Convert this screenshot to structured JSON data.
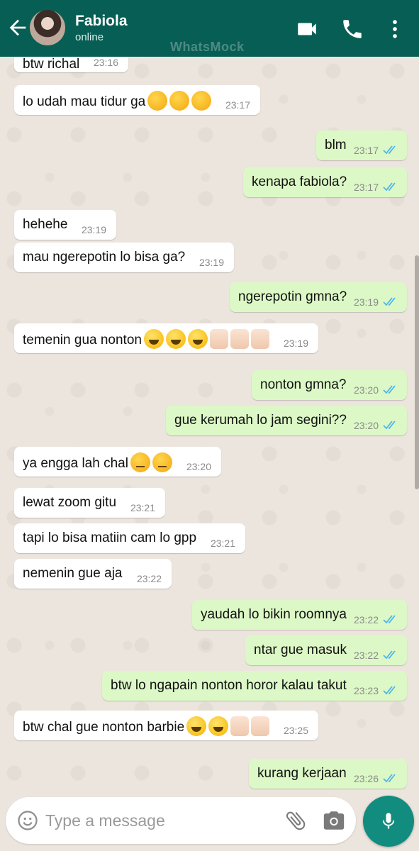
{
  "header": {
    "contact_name": "Fabiola",
    "status": "online",
    "watermark": "WhatsMock",
    "icons": [
      "back-arrow-icon",
      "video-call-icon",
      "phone-icon",
      "more-vert-icon"
    ]
  },
  "messages": [
    {
      "dir": "in",
      "text": "btw richal",
      "time": "23:16",
      "emojis": []
    },
    {
      "dir": "in",
      "text": "lo udah mau tidur ga",
      "time": "23:17",
      "emojis": [
        "think",
        "think",
        "think"
      ]
    },
    {
      "dir": "out",
      "text": "blm",
      "time": "23:17",
      "emojis": []
    },
    {
      "dir": "out",
      "text": "kenapa fabiola?",
      "time": "23:17",
      "emojis": []
    },
    {
      "dir": "in",
      "text": "hehehe",
      "time": "23:19",
      "emojis": []
    },
    {
      "dir": "in",
      "text": "mau ngerepotin lo bisa ga?",
      "time": "23:19",
      "emojis": []
    },
    {
      "dir": "out",
      "text": "ngerepotin gmna?",
      "time": "23:19",
      "emojis": []
    },
    {
      "dir": "in",
      "text": "temenin gua nonton",
      "time": "23:19",
      "emojis": [
        "smile",
        "smile",
        "smile",
        "thumb",
        "thumb",
        "thumb"
      ]
    },
    {
      "dir": "out",
      "text": "nonton gmna?",
      "time": "23:20",
      "emojis": []
    },
    {
      "dir": "out",
      "text": "gue kerumah lo jam segini??",
      "time": "23:20",
      "emojis": []
    },
    {
      "dir": "in",
      "text": "ya engga lah chal",
      "time": "23:20",
      "emojis": [
        "pensive",
        "pensive"
      ]
    },
    {
      "dir": "in",
      "text": "lewat zoom gitu",
      "time": "23:21",
      "emojis": []
    },
    {
      "dir": "in",
      "text": "tapi lo bisa matiin cam lo gpp",
      "time": "23:21",
      "emojis": []
    },
    {
      "dir": "in",
      "text": "nemenin gue aja",
      "time": "23:22",
      "emojis": []
    },
    {
      "dir": "out",
      "text": "yaudah lo bikin roomnya",
      "time": "23:22",
      "emojis": []
    },
    {
      "dir": "out",
      "text": "ntar gue masuk",
      "time": "23:22",
      "emojis": []
    },
    {
      "dir": "out",
      "text": "btw lo ngapain nonton horor kalau takut",
      "time": "23:23",
      "emojis": []
    },
    {
      "dir": "in",
      "text": "btw chal gue nonton barbie",
      "time": "23:25",
      "emojis": [
        "smile",
        "smile",
        "thumb",
        "thumb"
      ]
    },
    {
      "dir": "out",
      "text": "kurang kerjaan",
      "time": "23:26",
      "emojis": []
    }
  ],
  "input": {
    "placeholder": "Type a message",
    "icons": [
      "emoji-icon",
      "attach-icon",
      "camera-icon",
      "mic-icon"
    ]
  },
  "colors": {
    "header": "#075e54",
    "chat_bg": "#ece5dd",
    "bubble_out": "#dcf8c6",
    "bubble_in": "#ffffff",
    "read_tick": "#4fb6ec",
    "mic_button": "#128c7e"
  }
}
